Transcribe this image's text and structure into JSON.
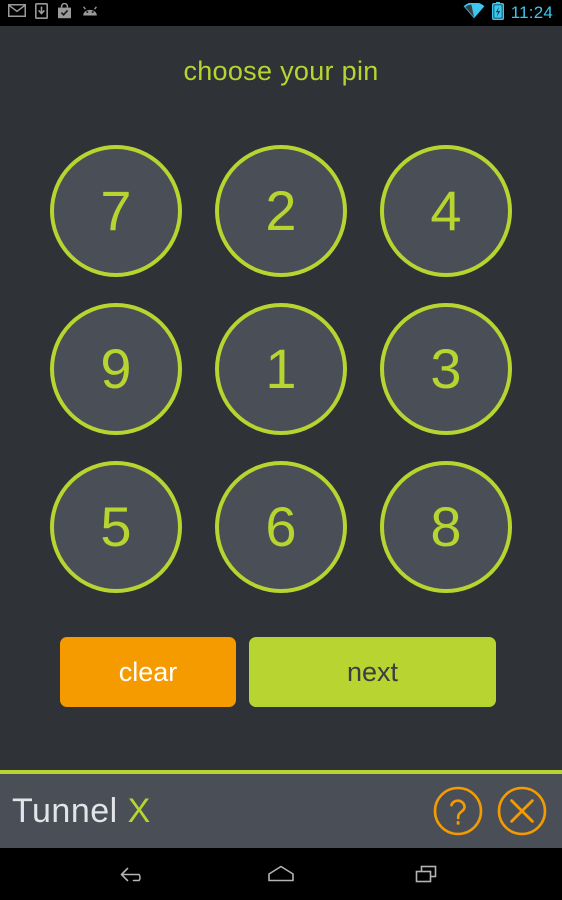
{
  "status_bar": {
    "left_icons": [
      {
        "name": "email-icon",
        "label": "email"
      },
      {
        "name": "download-icon",
        "label": "download"
      },
      {
        "name": "play-store-icon",
        "label": "play store"
      },
      {
        "name": "android-icon",
        "label": "android"
      }
    ],
    "right_icons": [
      {
        "name": "wifi-icon",
        "label": "wifi"
      },
      {
        "name": "battery-charging-icon",
        "label": "battery charging"
      }
    ],
    "clock": "11:24"
  },
  "screen": {
    "title": "choose your pin"
  },
  "keypad": {
    "rows": [
      [
        "7",
        "2",
        "4"
      ],
      [
        "9",
        "1",
        "3"
      ],
      [
        "5",
        "6",
        "8"
      ]
    ]
  },
  "actions": {
    "clear_label": "clear",
    "next_label": "next"
  },
  "bottom_bar": {
    "brand_name": "Tunnel",
    "brand_suffix": "X",
    "help_icon": "question-mark-circle-icon",
    "close_icon": "close-circle-icon"
  },
  "nav_bar": {
    "back_icon": "back-arrow-icon",
    "home_icon": "home-icon",
    "recents_icon": "recent-apps-icon"
  },
  "colors": {
    "background": "#2f3237",
    "accent_green": "#b8d430",
    "accent_orange": "#f59b00",
    "key_fill": "#4a4f57",
    "bottom_bar": "#4a4f57",
    "clock_blue": "#3dc7ef",
    "brand_text": "#e2e5e7"
  }
}
